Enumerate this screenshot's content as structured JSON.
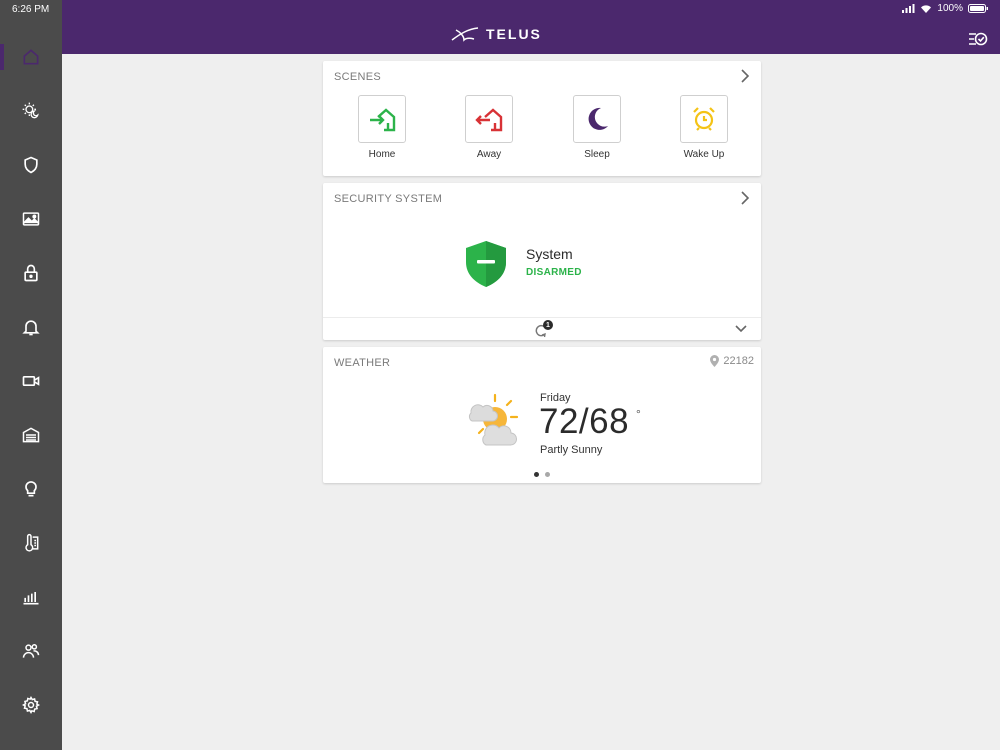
{
  "status_bar": {
    "time": "6:26 PM",
    "battery": "100%"
  },
  "header": {
    "brand": "TELUS"
  },
  "sidebar": {
    "items": [
      {
        "icon": "home-icon"
      },
      {
        "icon": "scenes-icon"
      },
      {
        "icon": "shield-icon"
      },
      {
        "icon": "image-icon"
      },
      {
        "icon": "lock-icon"
      },
      {
        "icon": "bell-icon"
      },
      {
        "icon": "video-camera-icon"
      },
      {
        "icon": "garage-icon"
      },
      {
        "icon": "lightbulb-icon"
      },
      {
        "icon": "thermostat-icon"
      },
      {
        "icon": "bar-chart-icon"
      },
      {
        "icon": "users-icon"
      },
      {
        "icon": "gear-icon"
      }
    ]
  },
  "scenes": {
    "title": "SCENES",
    "items": [
      {
        "label": "Home",
        "color": "#2cb34a"
      },
      {
        "label": "Away",
        "color": "#d83236"
      },
      {
        "label": "Sleep",
        "color": "#4b286d"
      },
      {
        "label": "Wake Up",
        "color": "#f4c316"
      }
    ]
  },
  "security": {
    "title": "SECURITY SYSTEM",
    "system_label": "System",
    "status": "DISARMED",
    "badge_count": "1",
    "status_color": "#2cb34a"
  },
  "weather": {
    "title": "WEATHER",
    "zip": "22182",
    "day": "Friday",
    "temp": "72/68",
    "degree": "°",
    "condition": "Partly Sunny"
  },
  "colors": {
    "brand_purple": "#4b286d",
    "sidebar_bg": "#4b4b4b",
    "page_bg": "#efefef"
  }
}
